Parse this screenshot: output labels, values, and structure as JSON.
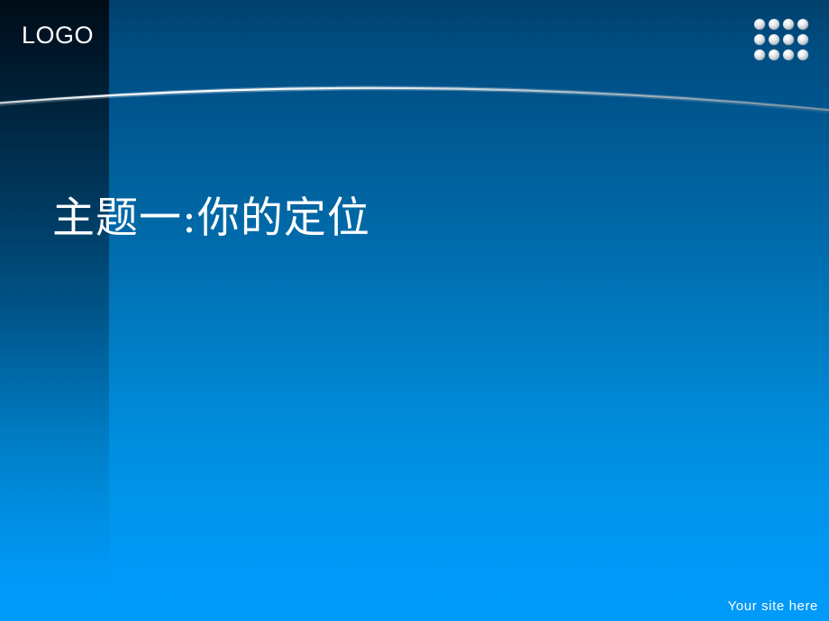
{
  "slide": {
    "logo": "LOGO",
    "title": "主题一:你的定位",
    "footer": "Your site here",
    "body_text": ""
  },
  "decoration": {
    "dot_grid": {
      "icon": "dot-grid-icon",
      "columns": 4,
      "rows": 3,
      "count": 12
    },
    "arc": {
      "icon": "swoosh-arc-icon"
    }
  },
  "colors": {
    "background_top": "#003F6B",
    "background_bottom": "#009AFA",
    "left_panel": "#000A14",
    "text": "#FFFFFF",
    "arc_highlight": "#FFFFFF",
    "arc_shadow": "#8C9AA5",
    "dot_light": "#FFFFFF",
    "dot_shadow": "#7D888F"
  }
}
